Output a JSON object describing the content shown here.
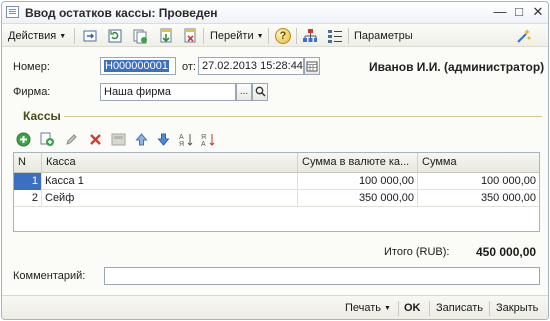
{
  "window": {
    "title": "Ввод остатков кассы: Проведен",
    "controls": [
      "—",
      "□",
      "✕"
    ]
  },
  "toolbar": {
    "actions_label": "Действия",
    "goto_label": "Перейти",
    "help_label": "?",
    "params_label": "Параметры"
  },
  "form": {
    "number_label": "Номер:",
    "number_value": "Н000000001",
    "date_label": "от:",
    "date_value": "27.02.2013 15:28:44",
    "user": "Иванов И.И. (администратор)",
    "org_label": "Фирма:",
    "org_value": "Наша фирма",
    "org_select_btn": "...",
    "section_title": "Кассы",
    "comment_label": "Комментарий:",
    "comment_value": ""
  },
  "table": {
    "columns": [
      "N",
      "Касса",
      "Сумма в валюте ка...",
      "Сумма"
    ],
    "rows": [
      {
        "n": "1",
        "kassa": "Касса 1",
        "sum_currency": "100 000,00",
        "sum": "100 000,00"
      },
      {
        "n": "2",
        "kassa": "Сейф",
        "sum_currency": "350 000,00",
        "sum": "350 000,00"
      }
    ]
  },
  "totals": {
    "label": "Итого (RUB):",
    "value": "450 000,00"
  },
  "footer": {
    "print_label": "Печать",
    "ok_label": "OK",
    "save_label": "Записать",
    "close_label": "Закрыть"
  },
  "colors": {
    "selection": "#3c6fc0",
    "section_line": "#d9c98e",
    "window_border": "#9fb4cf"
  }
}
